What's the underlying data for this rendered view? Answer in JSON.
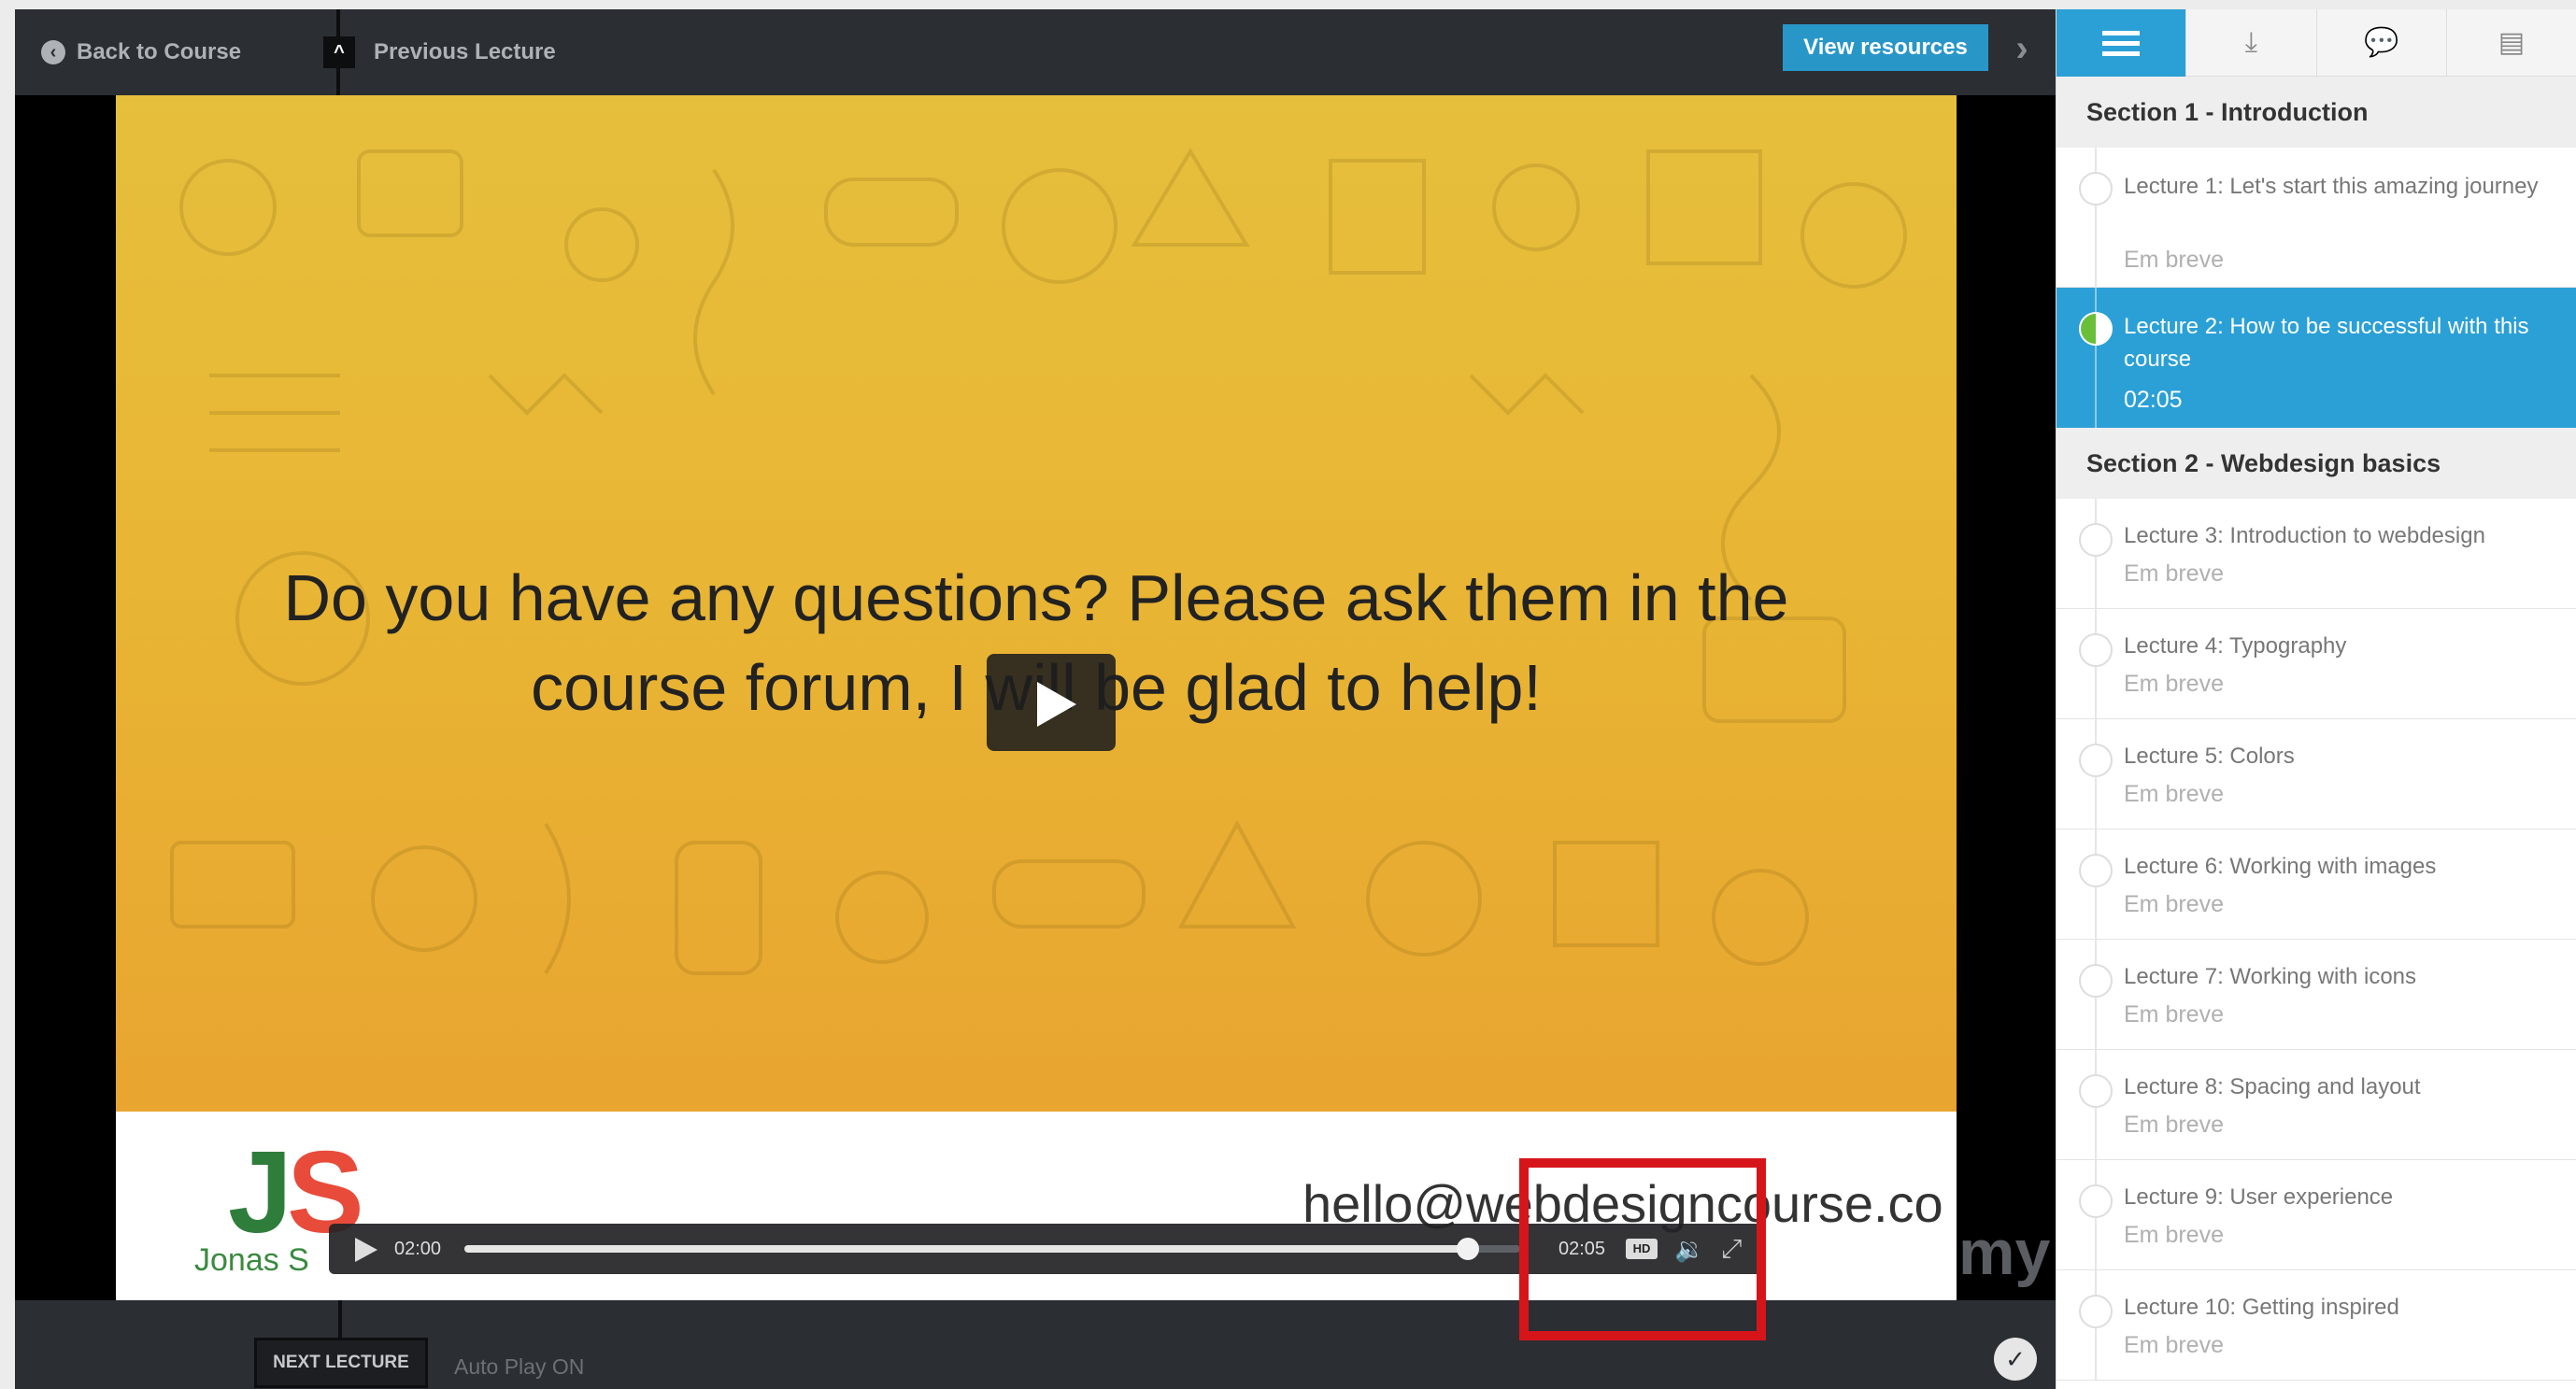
{
  "topbar": {
    "back_label": "Back to Course",
    "prev_label": "Previous Lecture",
    "resources_label": "View resources"
  },
  "slide": {
    "question_line1": "Do you have any questions? Please ask them in the",
    "question_line2": "course forum, I will be glad to help!",
    "logo_j": "J",
    "logo_s": "S",
    "logo_name": "Jonas S",
    "email": "hello@webdesigncourse.co",
    "udemy_fragment": "my"
  },
  "player": {
    "current_time": "02:00",
    "total_time": "02:05",
    "progress_fraction": 0.95,
    "hd_label": "HD"
  },
  "bottombar": {
    "next_label": "NEXT LECTURE",
    "autoplay_label": "Auto Play ON"
  },
  "sidebar": {
    "tabs": [
      "curriculum",
      "downloads",
      "discussion",
      "notes"
    ],
    "sections": [
      {
        "title": "Section 1 - Introduction"
      },
      {
        "title": "Section 2 - Webdesign basics"
      }
    ],
    "lectures": [
      {
        "title": "Lecture 1: Let's start this amazing journey",
        "meta": "Em breve"
      },
      {
        "title": "Lecture 2: How to be successful with this course",
        "meta": "02:05"
      },
      {
        "title": "Lecture 3: Introduction to webdesign",
        "meta": "Em breve"
      },
      {
        "title": "Lecture 4: Typography",
        "meta": "Em breve"
      },
      {
        "title": "Lecture 5: Colors",
        "meta": "Em breve"
      },
      {
        "title": "Lecture 6: Working with images",
        "meta": "Em breve"
      },
      {
        "title": "Lecture 7: Working with icons",
        "meta": "Em breve"
      },
      {
        "title": "Lecture 8: Spacing and layout",
        "meta": "Em breve"
      },
      {
        "title": "Lecture 9: User experience",
        "meta": "Em breve"
      },
      {
        "title": "Lecture 10: Getting inspired",
        "meta": "Em breve"
      }
    ]
  },
  "colors": {
    "accent": "#2ba0d6",
    "resources_button": "#2996c8",
    "highlight": "#d6151b",
    "slide_yellow": "#e6bf3c",
    "slide_orange": "#e8a530"
  },
  "icons": {
    "back": "circle-chevron-left-icon",
    "prev": "chevron-up-icon",
    "next": "chevron-right-icon",
    "complete": "check-circle-icon"
  }
}
